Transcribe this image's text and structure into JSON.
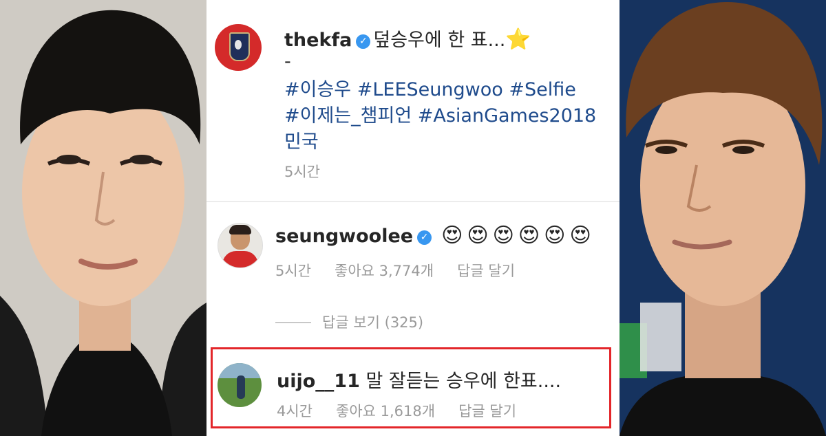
{
  "post": {
    "username": "thekfa",
    "caption": "덮승우에 한 표...",
    "star_emoji": "⭐",
    "dash": "-",
    "hashtags_line1": "#이승우 #LEESeungwoo #Selfie",
    "hashtags_line2": "#이제는_챔피언 #AsianGames2018",
    "hashtags_line3": "민국",
    "time": "5시간"
  },
  "comments": [
    {
      "username": "seungwoolee",
      "text": "😍😍😍😍😍😍",
      "time": "5시간",
      "likes": "좋아요 3,774개",
      "reply_label": "답글 달기",
      "view_replies": "답글 보기 (325)"
    },
    {
      "username": "uijo__11",
      "text": "말 잘듣는 승우에 한표....",
      "time": "4시간",
      "likes": "좋아요 1,618개",
      "reply_label": "답글 달기"
    }
  ],
  "icons": {
    "verified": "verified-badge-icon",
    "star": "star-emoji-icon"
  },
  "colors": {
    "hashtag": "#1f4b8c",
    "verified": "#3897f0",
    "highlight_border": "#e3262a",
    "meta_text": "#9a9a9a"
  }
}
